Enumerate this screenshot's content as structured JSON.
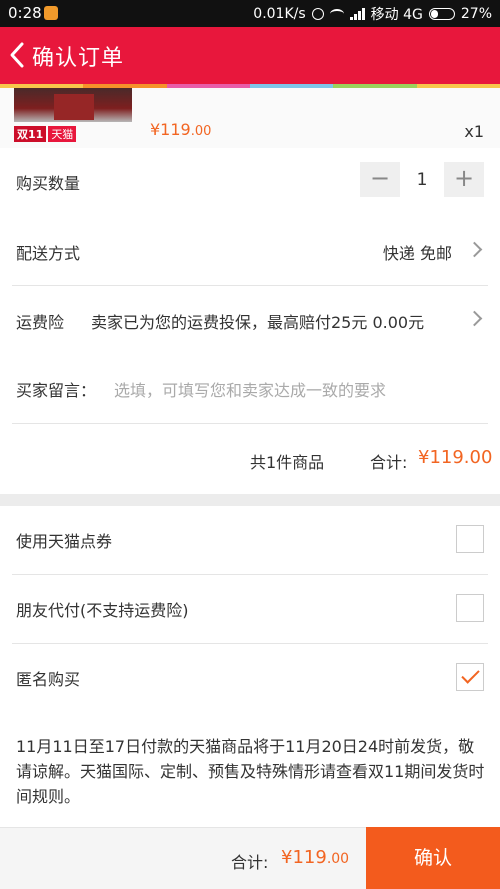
{
  "status_bar": {
    "time": "0:28",
    "network_speed": "0.01K/s",
    "carrier": "移动 4G",
    "battery": "27%"
  },
  "header": {
    "title": "确认订单"
  },
  "product": {
    "badge_double11": "双11",
    "badge_tmall": "天猫",
    "price_main": "¥119",
    "price_cents": ".00",
    "quantity": "x1"
  },
  "order": {
    "quantity_label": "购买数量",
    "quantity_value": "1",
    "minus": "−",
    "plus": "+",
    "delivery_label": "配送方式",
    "delivery_value": "快递 免邮",
    "insurance_label": "运费险",
    "insurance_text": "卖家已为您的运费投保，最高赔付25元 0.00元",
    "message_label": "买家留言：",
    "message_placeholder": "选填，可填写您和卖家达成一致的要求",
    "item_count": "共1件商品",
    "total_label": "合计:",
    "total_value": "¥119.00"
  },
  "options": {
    "voucher_label": "使用天猫点券",
    "voucher_checked": false,
    "friend_pay_label": "朋友代付(不支持运费险)",
    "friend_pay_checked": false,
    "anonymous_label": "匿名购买",
    "anonymous_checked": true
  },
  "notice": "11月11日至17日付款的天猫商品将于11月20日24时前发货，敬请谅解。天猫国际、定制、预售及特殊情形请查看双11期间发货时间规则。",
  "bottom": {
    "total_label": "合计:",
    "total_main": "¥119",
    "total_cents": ".00",
    "confirm_label": "确认"
  },
  "colors": {
    "header": "#e8173c",
    "accent": "#f26522",
    "confirm": "#f35b1d"
  }
}
